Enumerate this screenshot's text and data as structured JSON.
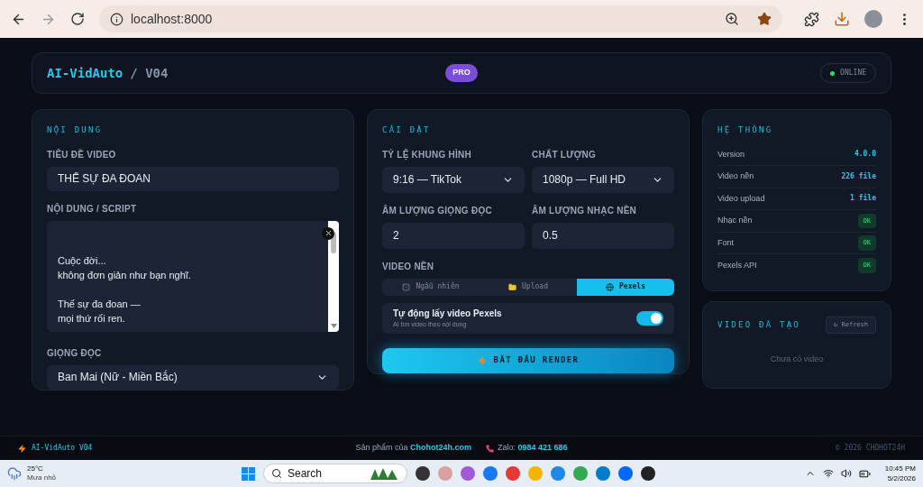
{
  "browser": {
    "url": "localhost:8000"
  },
  "header": {
    "brand": "AI-VidAuto",
    "version": "/ V04",
    "badge": "PRO",
    "status": "ONLINE",
    "online": true
  },
  "content_panel": {
    "title": "NỘI DUNG",
    "title_label": "TIÊU ĐỀ VIDEO",
    "title_value": "THẾ SỰ ĐA ĐOAN",
    "script_label": "NỘI DUNG / SCRIPT",
    "script_paragraphs": [
      {
        "lines": [
          "Cuộc đời...",
          "không đơn giản như bạn nghĩ."
        ]
      },
      {
        "lines": [
          "Thế sự đa đoan —",
          "mọi thứ rối ren."
        ]
      }
    ],
    "voice_label": "GIỌNG ĐỌC",
    "voice_value": "Ban Mai (Nữ - Miền Bắc)"
  },
  "settings_panel": {
    "title": "CÀI ĐẶT",
    "ratio_label": "TỶ LỆ KHUNG HÌNH",
    "ratio_value": "9:16 — TikTok",
    "quality_label": "CHẤT LƯỢNG",
    "quality_value": "1080p — Full HD",
    "voice_volume_label": "ÂM LƯỢNG GIỌNG ĐỌC",
    "voice_volume_value": "2",
    "music_volume_label": "ÂM LƯỢNG NHẠC NỀN",
    "music_volume_value": "0.5",
    "source_label": "VIDEO NỀN",
    "sources": [
      {
        "label": "Ngẫu nhiên",
        "selected": false
      },
      {
        "label": "Upload",
        "selected": false
      },
      {
        "label": "Pexels",
        "selected": true
      }
    ],
    "auto_title": "Tự động lấy video Pexels",
    "auto_hint": "AI tìm video theo nội dung",
    "auto_on": true,
    "render_button": "BẮT ĐẦU RENDER"
  },
  "system_panel": {
    "title": "HỆ THỐNG",
    "rows": [
      {
        "label": "Version",
        "value": "4.0.0",
        "kind": "value"
      },
      {
        "label": "Video nền",
        "value": "226 file",
        "kind": "value"
      },
      {
        "label": "Video upload",
        "value": "1 file",
        "kind": "value"
      },
      {
        "label": "Nhạc nền",
        "value": "OK",
        "kind": "badge"
      },
      {
        "label": "Font",
        "value": "OK",
        "kind": "badge"
      },
      {
        "label": "Pexels API",
        "value": "OK",
        "kind": "badge"
      }
    ]
  },
  "videos_panel": {
    "title": "VIDEO ĐÃ TẠO",
    "refresh": "↻ Refresh",
    "empty": "Chưa có video"
  },
  "footer": {
    "brand": "AI-VidAuto V04",
    "product_prefix": "Sản phẩm của",
    "product_link": "Chohot24h.com",
    "zalo_prefix": "Zalo:",
    "zalo_number": "0984 421 686",
    "copyright": "© 2026 CHOHOT24H"
  },
  "taskbar": {
    "temperature": "25°C",
    "weather": "Mưa nhỏ",
    "search": "Search",
    "time": "10:45 PM",
    "date": "5/2/2026"
  }
}
